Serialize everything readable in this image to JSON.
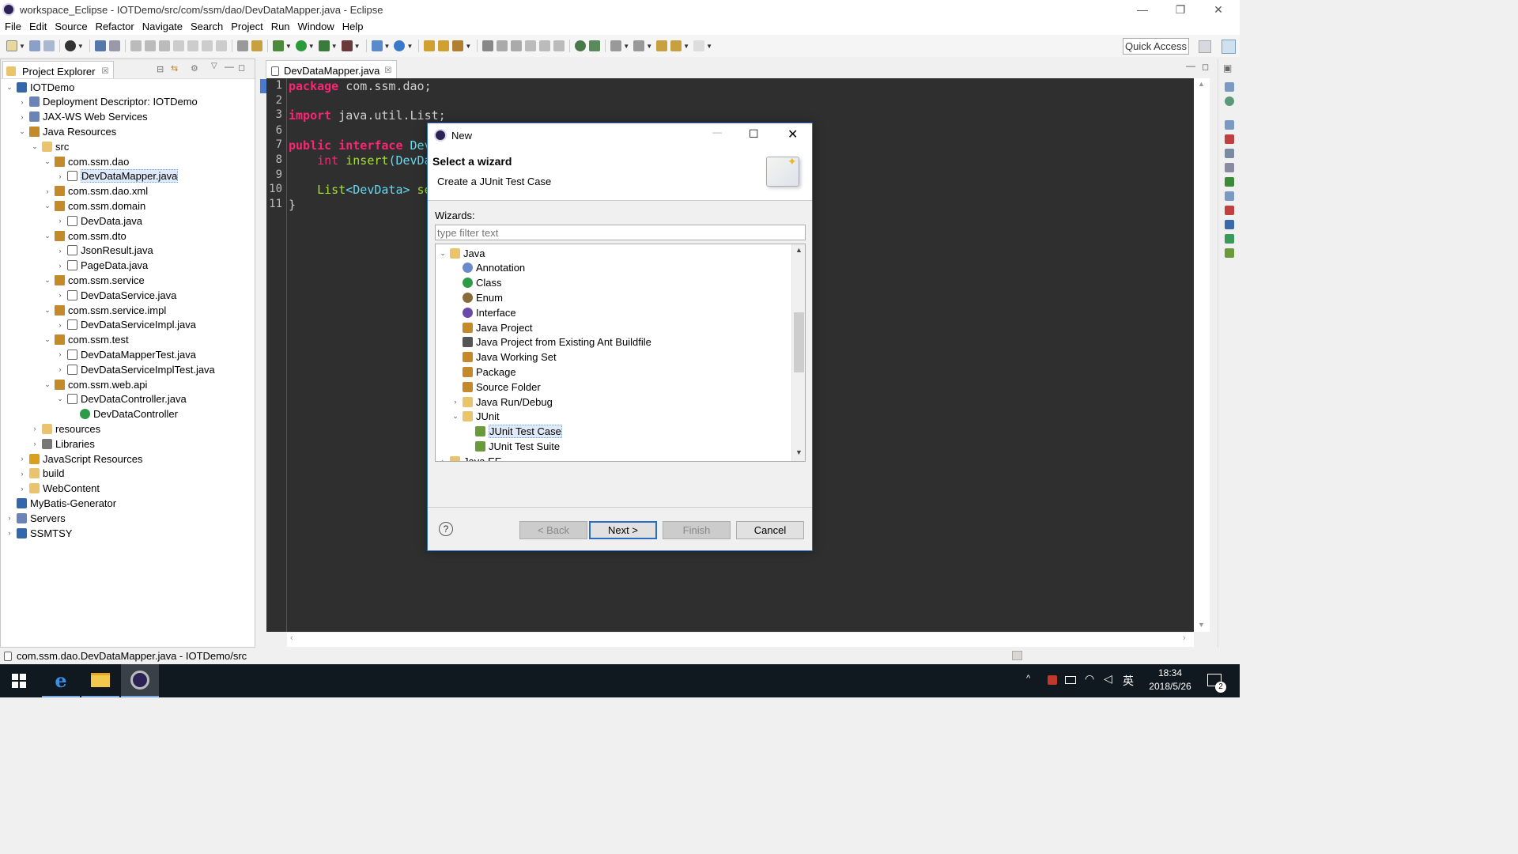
{
  "window": {
    "title": "workspace_Eclipse - IOTDemo/src/com/ssm/dao/DevDataMapper.java - Eclipse"
  },
  "menu": [
    "File",
    "Edit",
    "Source",
    "Refactor",
    "Navigate",
    "Search",
    "Project",
    "Run",
    "Window",
    "Help"
  ],
  "quick_access": "Quick Access",
  "explorer": {
    "tab_label": "Project Explorer",
    "tree": [
      {
        "label": "IOTDemo",
        "level": 0,
        "expanded": true,
        "icon": "project-icon"
      },
      {
        "label": "Deployment Descriptor: IOTDemo",
        "level": 1,
        "expanded": false,
        "icon": "descriptor-icon"
      },
      {
        "label": "JAX-WS Web Services",
        "level": 1,
        "expanded": false,
        "icon": "webservice-icon"
      },
      {
        "label": "Java Resources",
        "level": 1,
        "expanded": true,
        "icon": "java-resources-icon"
      },
      {
        "label": "src",
        "level": 2,
        "expanded": true,
        "icon": "source-folder-icon"
      },
      {
        "label": "com.ssm.dao",
        "level": 3,
        "expanded": true,
        "icon": "package-icon"
      },
      {
        "label": "DevDataMapper.java",
        "level": 4,
        "expanded": false,
        "icon": "java-file-icon",
        "selected": true
      },
      {
        "label": "com.ssm.dao.xml",
        "level": 3,
        "expanded": false,
        "icon": "package-icon"
      },
      {
        "label": "com.ssm.domain",
        "level": 3,
        "expanded": true,
        "icon": "package-icon"
      },
      {
        "label": "DevData.java",
        "level": 4,
        "expanded": false,
        "icon": "java-file-icon"
      },
      {
        "label": "com.ssm.dto",
        "level": 3,
        "expanded": true,
        "icon": "package-icon"
      },
      {
        "label": "JsonResult.java",
        "level": 4,
        "expanded": false,
        "icon": "java-file-icon"
      },
      {
        "label": "PageData.java",
        "level": 4,
        "expanded": false,
        "icon": "java-file-icon"
      },
      {
        "label": "com.ssm.service",
        "level": 3,
        "expanded": true,
        "icon": "package-icon"
      },
      {
        "label": "DevDataService.java",
        "level": 4,
        "expanded": false,
        "icon": "java-file-icon"
      },
      {
        "label": "com.ssm.service.impl",
        "level": 3,
        "expanded": true,
        "icon": "package-icon"
      },
      {
        "label": "DevDataServiceImpl.java",
        "level": 4,
        "expanded": false,
        "icon": "java-file-icon"
      },
      {
        "label": "com.ssm.test",
        "level": 3,
        "expanded": true,
        "icon": "package-icon"
      },
      {
        "label": "DevDataMapperTest.java",
        "level": 4,
        "expanded": false,
        "icon": "java-file-icon"
      },
      {
        "label": "DevDataServiceImplTest.java",
        "level": 4,
        "expanded": false,
        "icon": "java-file-icon"
      },
      {
        "label": "com.ssm.web.api",
        "level": 3,
        "expanded": true,
        "icon": "package-icon"
      },
      {
        "label": "DevDataController.java",
        "level": 4,
        "expanded": true,
        "icon": "java-file-icon"
      },
      {
        "label": "DevDataController",
        "level": 5,
        "expanded": false,
        "icon": "class-icon",
        "leaf": true
      },
      {
        "label": "resources",
        "level": 2,
        "expanded": false,
        "icon": "folder-icon"
      },
      {
        "label": "Libraries",
        "level": 2,
        "expanded": false,
        "icon": "library-icon"
      },
      {
        "label": "JavaScript Resources",
        "level": 1,
        "expanded": false,
        "icon": "javascript-icon"
      },
      {
        "label": "build",
        "level": 1,
        "expanded": false,
        "icon": "folder-icon"
      },
      {
        "label": "WebContent",
        "level": 1,
        "expanded": false,
        "icon": "folder-icon"
      },
      {
        "label": "MyBatis-Generator",
        "level": 0,
        "expanded": false,
        "icon": "project-icon",
        "leaf": true
      },
      {
        "label": "Servers",
        "level": 0,
        "expanded": false,
        "icon": "servers-icon"
      },
      {
        "label": "SSMTSY",
        "level": 0,
        "expanded": false,
        "icon": "project-icon"
      }
    ]
  },
  "editor": {
    "tab_label": "DevDataMapper.java",
    "line_numbers": [
      "1",
      "2",
      "3",
      "6",
      "7",
      "8",
      "9",
      "10",
      "11"
    ],
    "lines": [
      {
        "n": "1",
        "parts": [
          {
            "t": "package",
            "c": "kw"
          },
          {
            "t": " com.ssm.dao;",
            "c": "pl"
          }
        ]
      },
      {
        "n": "2",
        "parts": []
      },
      {
        "n": "3",
        "parts": [
          {
            "t": "import",
            "c": "kw"
          },
          {
            "t": " java.util.List;",
            "c": "pl"
          }
        ]
      },
      {
        "n": "6",
        "parts": []
      },
      {
        "n": "7",
        "parts": [
          {
            "t": "public interface",
            "c": "kw"
          },
          {
            "t": " Dev",
            "c": "ty"
          }
        ]
      },
      {
        "n": "8",
        "parts": [
          {
            "t": "    int ",
            "c": "kw2"
          },
          {
            "t": "insert",
            "c": "fn"
          },
          {
            "t": "(DevDa",
            "c": "ty"
          }
        ]
      },
      {
        "n": "9",
        "parts": []
      },
      {
        "n": "10",
        "parts": [
          {
            "t": "    List",
            "c": "fn"
          },
          {
            "t": "<DevData>",
            "c": "ty"
          },
          {
            "t": " se",
            "c": "fn"
          }
        ]
      },
      {
        "n": "11",
        "parts": [
          {
            "t": "}",
            "c": "pl"
          }
        ]
      }
    ]
  },
  "status": {
    "text": "com.ssm.dao.DevDataMapper.java - IOTDemo/src"
  },
  "dialog": {
    "title": "New",
    "heading": "Select a wizard",
    "description": "Create a JUnit Test Case",
    "wizards_label": "Wizards:",
    "filter_placeholder": "type filter text",
    "tree": [
      {
        "label": "Java",
        "level": 0,
        "expanded": true,
        "icon": "folder-icon"
      },
      {
        "label": "Annotation",
        "level": 1,
        "icon": "annotation-icon"
      },
      {
        "label": "Class",
        "level": 1,
        "icon": "class-icon"
      },
      {
        "label": "Enum",
        "level": 1,
        "icon": "enum-icon"
      },
      {
        "label": "Interface",
        "level": 1,
        "icon": "interface-icon"
      },
      {
        "label": "Java Project",
        "level": 1,
        "icon": "java-project-icon"
      },
      {
        "label": "Java Project from Existing Ant Buildfile",
        "level": 1,
        "icon": "ant-icon"
      },
      {
        "label": "Java Working Set",
        "level": 1,
        "icon": "working-set-icon"
      },
      {
        "label": "Package",
        "level": 1,
        "icon": "package-icon"
      },
      {
        "label": "Source Folder",
        "level": 1,
        "icon": "source-folder-icon"
      },
      {
        "label": "Java Run/Debug",
        "level": 0,
        "expanded": false,
        "indent": 1,
        "icon": "folder-icon"
      },
      {
        "label": "JUnit",
        "level": 0,
        "expanded": true,
        "indent": 1,
        "icon": "folder-icon"
      },
      {
        "label": "JUnit Test Case",
        "level": 2,
        "icon": "junit-test-case-icon",
        "selected": true
      },
      {
        "label": "JUnit Test Suite",
        "level": 2,
        "icon": "junit-test-suite-icon"
      },
      {
        "label": "Java EE",
        "level": 0,
        "expanded": false,
        "icon": "folder-icon"
      }
    ],
    "buttons": {
      "help": "?",
      "back": "< Back",
      "next": "Next >",
      "finish": "Finish",
      "cancel": "Cancel"
    }
  },
  "taskbar": {
    "time": "18:34",
    "date": "2018/5/26",
    "ime": "英",
    "notif_count": "2"
  }
}
